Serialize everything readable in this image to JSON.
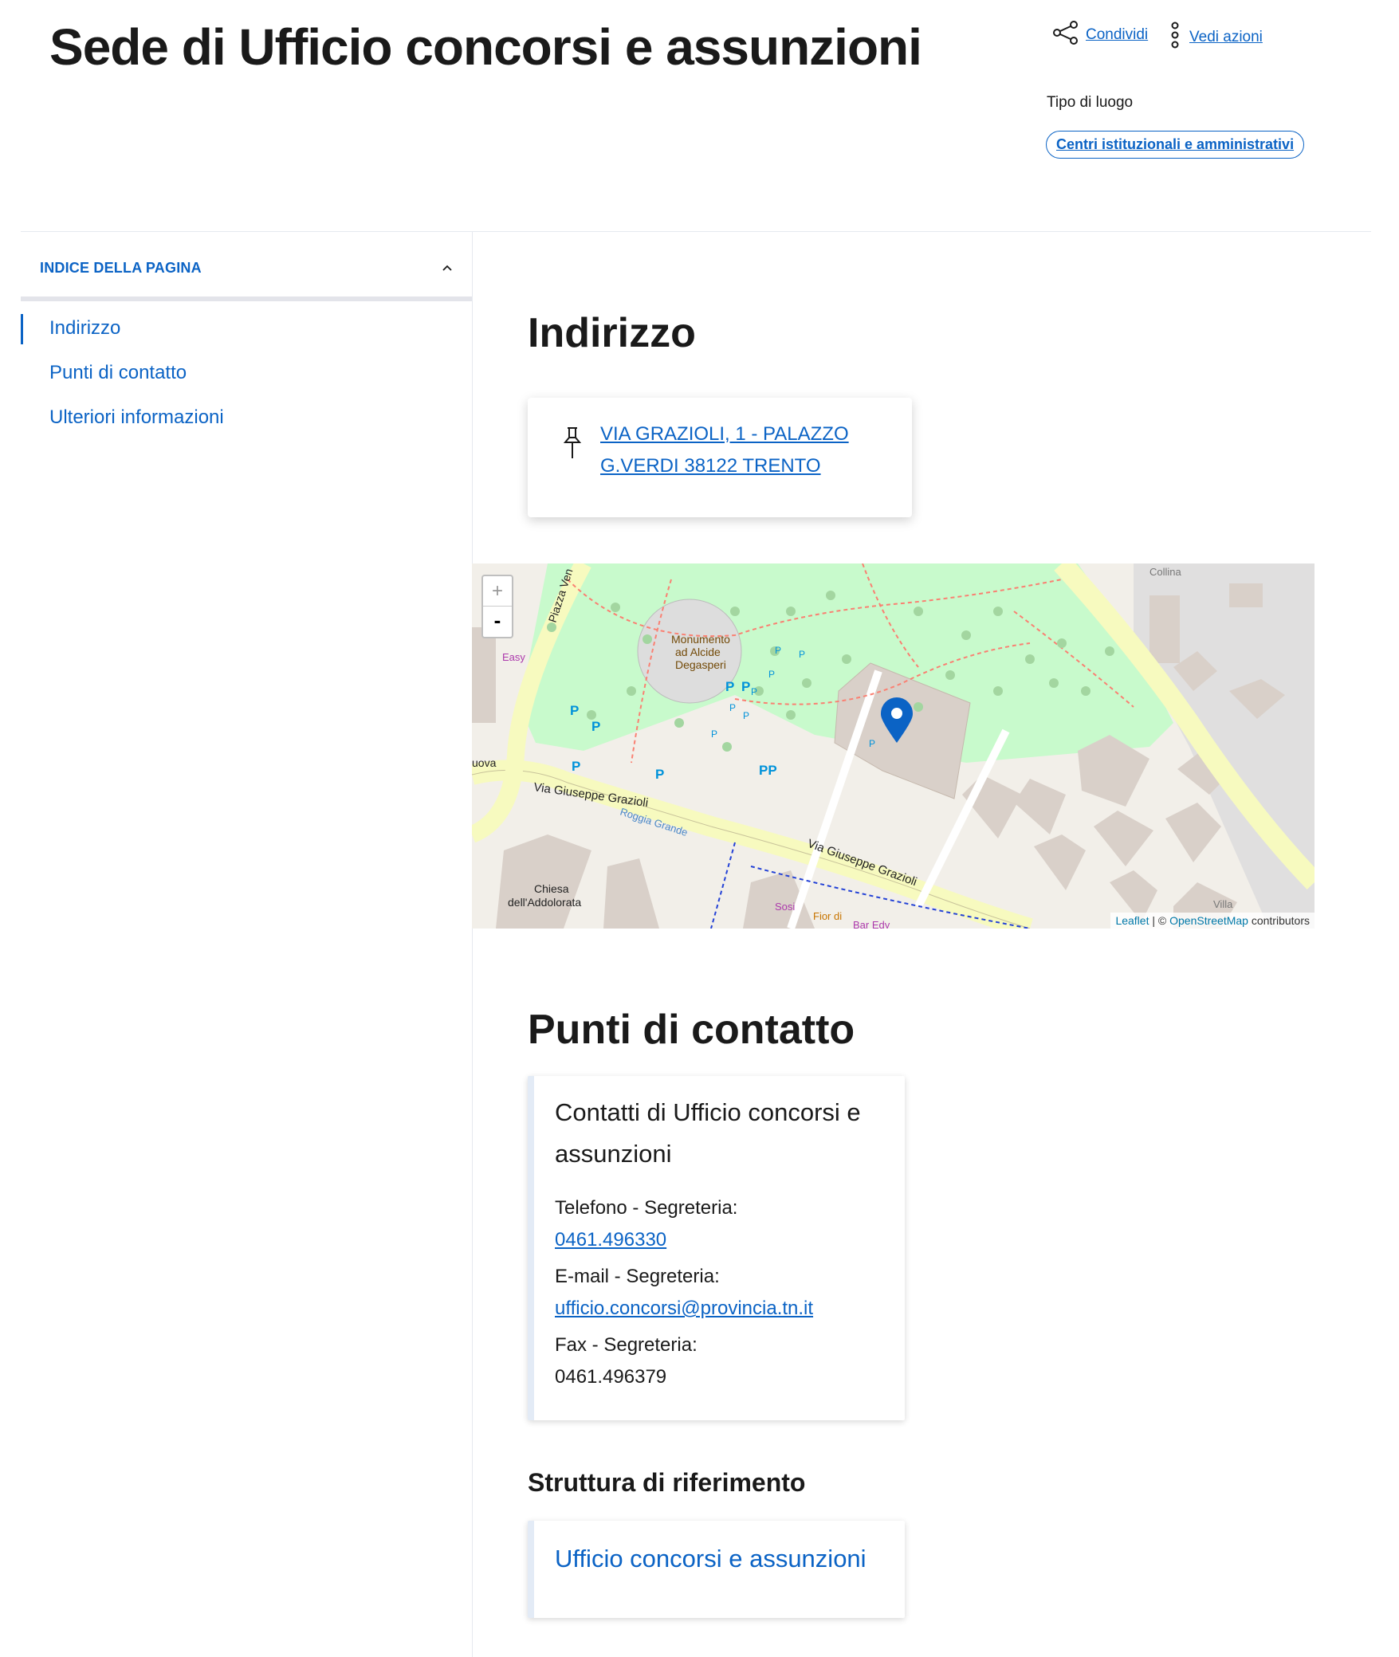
{
  "header": {
    "title": "Sede di Ufficio concorsi e assunzioni",
    "share_label": "Condividi",
    "actions_label": "Vedi azioni",
    "tipo_label": "Tipo di luogo",
    "tipo_value": "Centri istituzionali e amministrativi"
  },
  "index": {
    "title": "INDICE DELLA PAGINA",
    "items": [
      "Indirizzo",
      "Punti di contatto",
      "Ulteriori informazioni"
    ]
  },
  "address": {
    "heading": "Indirizzo",
    "line1": "VIA GRAZIOLI, 1 - PALAZZO",
    "line2": "G.VERDI 38122 TRENTO",
    "icon": "pin-icon"
  },
  "map": {
    "zoom_in": "+",
    "zoom_out": "-",
    "attribution_leaflet": "Leaflet",
    "attribution_sep": " | © ",
    "attribution_osm": "OpenStreetMap",
    "attribution_tail": " contributors",
    "labels": {
      "monument": [
        "Monumento",
        "ad Alcide",
        "Degasperi"
      ],
      "street1": "Via Giuseppe Grazioli",
      "street2": "Via Giuseppe Grazioli",
      "piazza": "Piazza Ven",
      "roggia": "Roggia Grande",
      "church": [
        "Chiesa",
        "dell'Addolorata"
      ],
      "collina": "Collina",
      "villa": "Villa",
      "easy": "Easy",
      "sosi": "Sosi",
      "nuova": "uova",
      "fior": "Fior di",
      "bar": "Bar Edy"
    },
    "colors": {
      "park": "#c8facc",
      "road": "#f7fabf",
      "building": "#d9d0c9",
      "marker": "#0b63c5"
    }
  },
  "contacts": {
    "heading": "Punti di contatto",
    "card_title": "Contatti di Ufficio concorsi e assunzioni",
    "phone_label": "Telefono - Segreteria:",
    "phone_value": "0461.496330",
    "email_label": "E-mail - Segreteria:",
    "email_value": "ufficio.concorsi@provincia.tn.it",
    "fax_label": "Fax - Segreteria:",
    "fax_value": "0461.496379"
  },
  "reference": {
    "heading": "Struttura di riferimento",
    "link": "Ufficio concorsi e assunzioni"
  }
}
